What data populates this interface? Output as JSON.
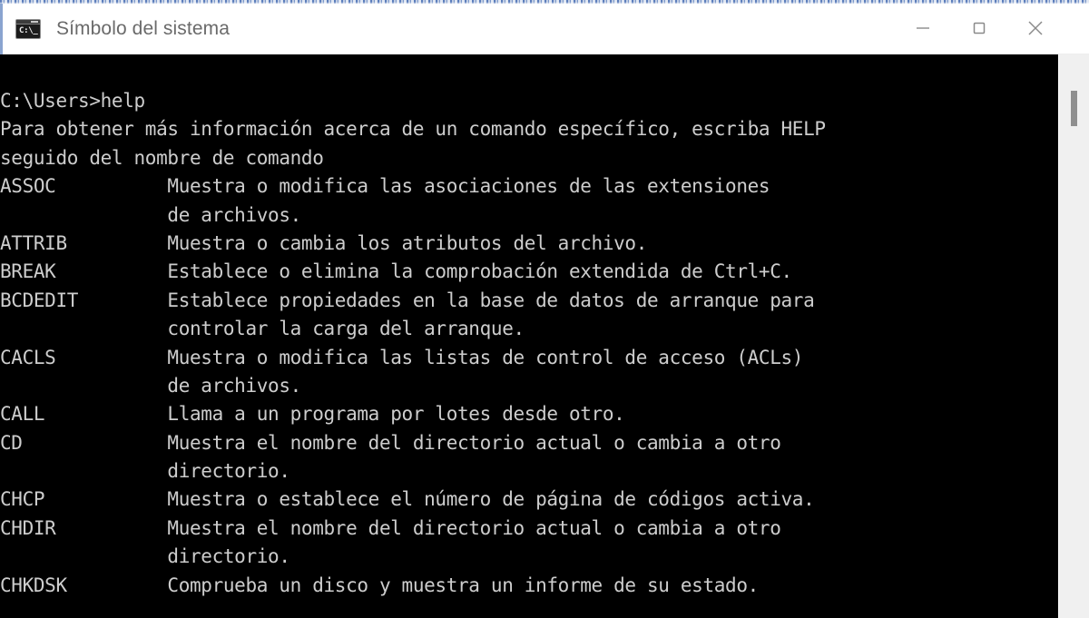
{
  "window": {
    "title": "Símbolo del sistema",
    "icon_name": "command-prompt-icon",
    "icon_text": "C:\\_",
    "controls": {
      "minimize_label": "Minimizar",
      "maximize_label": "Maximizar",
      "close_label": "Cerrar"
    },
    "colors": {
      "titlebar_bg": "#ffffff",
      "title_fg": "#6a6a6a",
      "terminal_bg": "#000000",
      "terminal_fg": "#cdcdcd",
      "scrollbar_track": "#f0f0f0",
      "scrollbar_thumb": "#8f8f8f"
    }
  },
  "terminal": {
    "prompt_line": "C:\\Users>help",
    "intro": [
      "Para obtener más información acerca de un comando específico, escriba HELP",
      "seguido del nombre de comando"
    ],
    "lines": [
      "C:\\Users>help",
      "Para obtener más información acerca de un comando específico, escriba HELP",
      "seguido del nombre de comando",
      "ASSOC          Muestra o modifica las asociaciones de las extensiones",
      "               de archivos.",
      "ATTRIB         Muestra o cambia los atributos del archivo.",
      "BREAK          Establece o elimina la comprobación extendida de Ctrl+C.",
      "BCDEDIT        Establece propiedades en la base de datos de arranque para",
      "               controlar la carga del arranque.",
      "CACLS          Muestra o modifica las listas de control de acceso (ACLs)",
      "               de archivos.",
      "CALL           Llama a un programa por lotes desde otro.",
      "CD             Muestra el nombre del directorio actual o cambia a otro",
      "               directorio.",
      "CHCP           Muestra o establece el número de página de códigos activa.",
      "CHDIR          Muestra el nombre del directorio actual o cambia a otro",
      "               directorio.",
      "CHKDSK         Comprueba un disco y muestra un informe de su estado."
    ],
    "commands": [
      {
        "name": "ASSOC",
        "description": [
          "Muestra o modifica las asociaciones de las extensiones",
          "de archivos."
        ]
      },
      {
        "name": "ATTRIB",
        "description": [
          "Muestra o cambia los atributos del archivo."
        ]
      },
      {
        "name": "BREAK",
        "description": [
          "Establece o elimina la comprobación extendida de Ctrl+C."
        ]
      },
      {
        "name": "BCDEDIT",
        "description": [
          "Establece propiedades en la base de datos de arranque para",
          "controlar la carga del arranque."
        ]
      },
      {
        "name": "CACLS",
        "description": [
          "Muestra o modifica las listas de control de acceso (ACLs)",
          "de archivos."
        ]
      },
      {
        "name": "CALL",
        "description": [
          "Llama a un programa por lotes desde otro."
        ]
      },
      {
        "name": "CD",
        "description": [
          "Muestra el nombre del directorio actual o cambia a otro",
          "directorio."
        ]
      },
      {
        "name": "CHCP",
        "description": [
          "Muestra o establece el número de página de códigos activa."
        ]
      },
      {
        "name": "CHDIR",
        "description": [
          "Muestra el nombre del directorio actual o cambia a otro",
          "directorio."
        ]
      },
      {
        "name": "CHKDSK",
        "description": [
          "Comprueba un disco y muestra un informe de su estado."
        ]
      }
    ]
  }
}
